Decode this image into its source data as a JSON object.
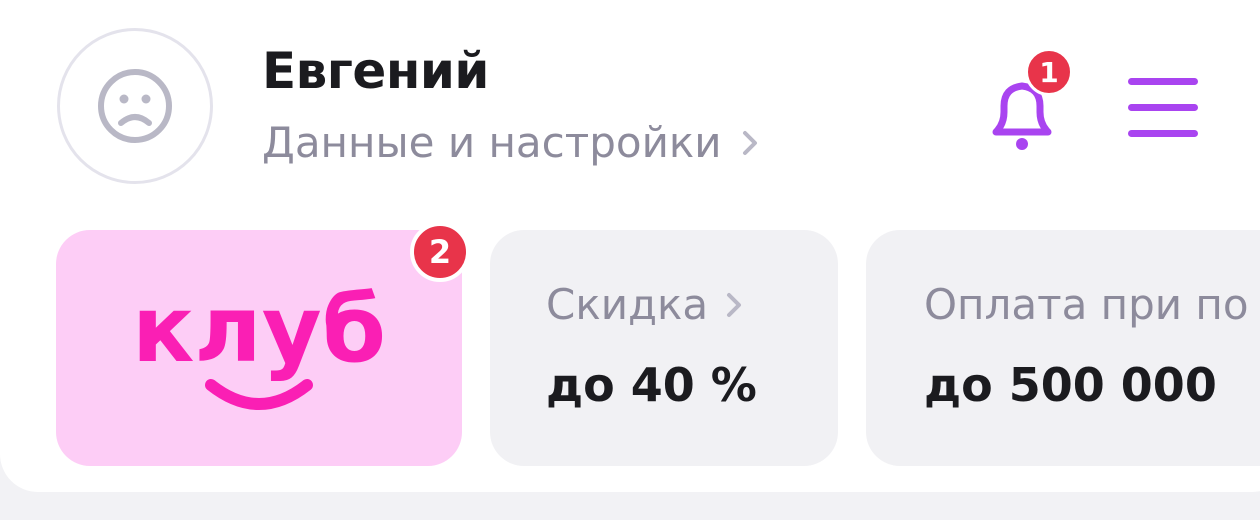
{
  "profile": {
    "name": "Евгений",
    "settings_link": "Данные и настройки",
    "avatar_icon": "sad-face-icon"
  },
  "header": {
    "notifications_badge": "1",
    "bell_icon": "bell-icon",
    "menu_icon": "hamburger-menu-icon",
    "accent_color": "#a944f0"
  },
  "tiles": {
    "club": {
      "logo_text": "клуб",
      "badge": "2",
      "bg_color": "#fdcdf6",
      "logo_color": "#fa1fb4"
    },
    "discount": {
      "label": "Скидка",
      "value": "до 40 %"
    },
    "payment": {
      "label": "Оплата при по",
      "value": "до 500 000"
    }
  },
  "colors": {
    "badge": "#e8344a",
    "text_primary": "#1b1b1f",
    "text_secondary": "#8d8b9c",
    "tile_gray": "#f1f1f4"
  }
}
